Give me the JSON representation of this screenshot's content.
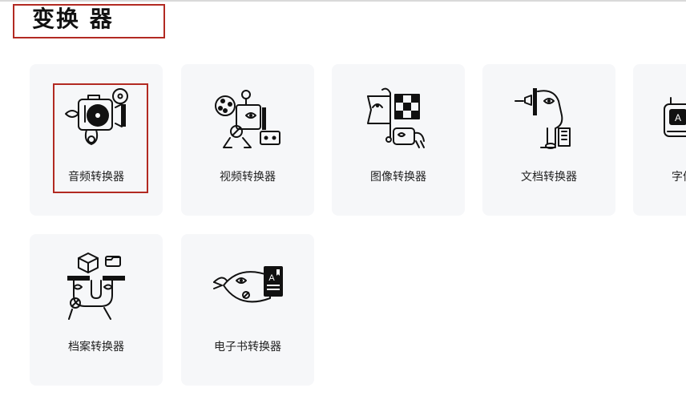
{
  "header": {
    "title": "变换 器"
  },
  "converters": [
    {
      "label": "音频转换器",
      "icon": "audio-converter-icon"
    },
    {
      "label": "视频转换器",
      "icon": "video-converter-icon"
    },
    {
      "label": "图像转换器",
      "icon": "image-converter-icon"
    },
    {
      "label": "文档转换器",
      "icon": "document-converter-icon"
    },
    {
      "label": "字体转换器",
      "icon": "font-converter-icon"
    },
    {
      "label": "档案转换器",
      "icon": "archive-converter-icon"
    },
    {
      "label": "电子书转换器",
      "icon": "ebook-converter-icon"
    }
  ],
  "colors": {
    "highlight_border": "#b22a22",
    "card_background": "#f6f7f9"
  }
}
